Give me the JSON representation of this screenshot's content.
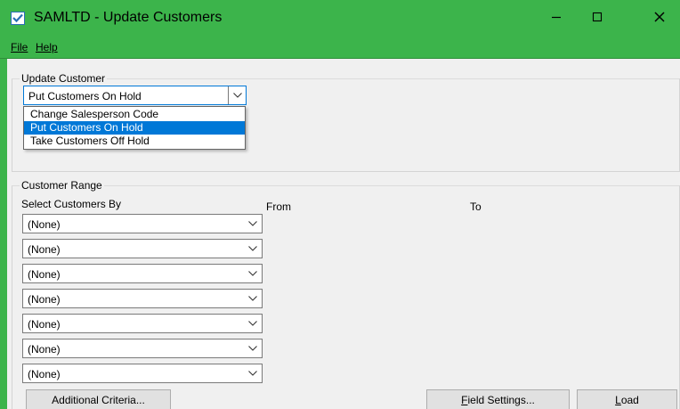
{
  "window": {
    "title": "SAMLTD - Update Customers",
    "accent_color": "#3cb44b",
    "controls": {
      "minimize_icon": "minimize-icon",
      "maximize_icon": "maximize-icon",
      "close_icon": "close-icon"
    }
  },
  "menubar": {
    "file": "File",
    "help": "Help"
  },
  "update_customer": {
    "group_label": "Update Customer",
    "selected_value": "Put Customers On Hold",
    "options": [
      {
        "label": "Change Salesperson Code",
        "selected": false
      },
      {
        "label": "Put Customers On Hold",
        "selected": true
      },
      {
        "label": "Take Customers Off Hold",
        "selected": false
      }
    ]
  },
  "customer_range": {
    "group_label": "Customer Range",
    "select_by_label": "Select Customers By",
    "from_label": "From",
    "to_label": "To",
    "rows": [
      {
        "value": "(None)"
      },
      {
        "value": "(None)"
      },
      {
        "value": "(None)"
      },
      {
        "value": "(None)"
      },
      {
        "value": "(None)"
      },
      {
        "value": "(None)"
      },
      {
        "value": "(None)"
      }
    ]
  },
  "buttons": {
    "additional_criteria": "Additional Criteria...",
    "field_settings_mnemonic": "F",
    "field_settings_rest": "ield Settings...",
    "load_mnemonic": "L",
    "load_rest": "oad"
  }
}
